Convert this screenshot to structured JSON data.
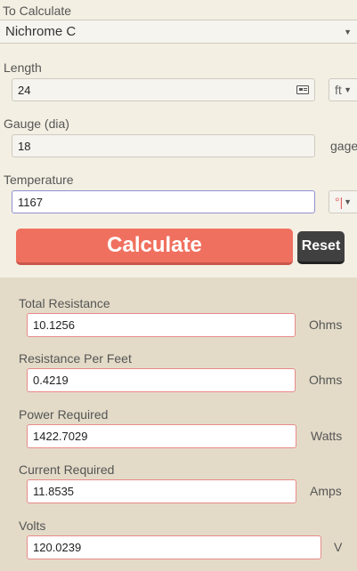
{
  "calc": {
    "label": "To Calculate",
    "value": "Nichrome C"
  },
  "length": {
    "label": "Length",
    "value": "24",
    "unit": "ft"
  },
  "gauge": {
    "label": "Gauge (dia)",
    "value": "18",
    "unit": "gage"
  },
  "temperature": {
    "label": "Temperature",
    "value": "1167",
    "unit": "°|"
  },
  "buttons": {
    "calculate": "Calculate",
    "reset": "Reset"
  },
  "results": [
    {
      "label": "Total Resistance",
      "value": "10.1256",
      "unit": "Ohms"
    },
    {
      "label": "Resistance Per Feet",
      "value": "0.4219",
      "unit": "Ohms"
    },
    {
      "label": "Power Required",
      "value": "1422.7029",
      "unit": "Watts"
    },
    {
      "label": "Current Required",
      "value": "11.8535",
      "unit": "Amps"
    },
    {
      "label": "Volts",
      "value": "120.0239",
      "unit": "V"
    }
  ],
  "colors": {
    "calculate_button": "#f0705f",
    "reset_button": "#404040",
    "result_border": "#e88a8a"
  }
}
